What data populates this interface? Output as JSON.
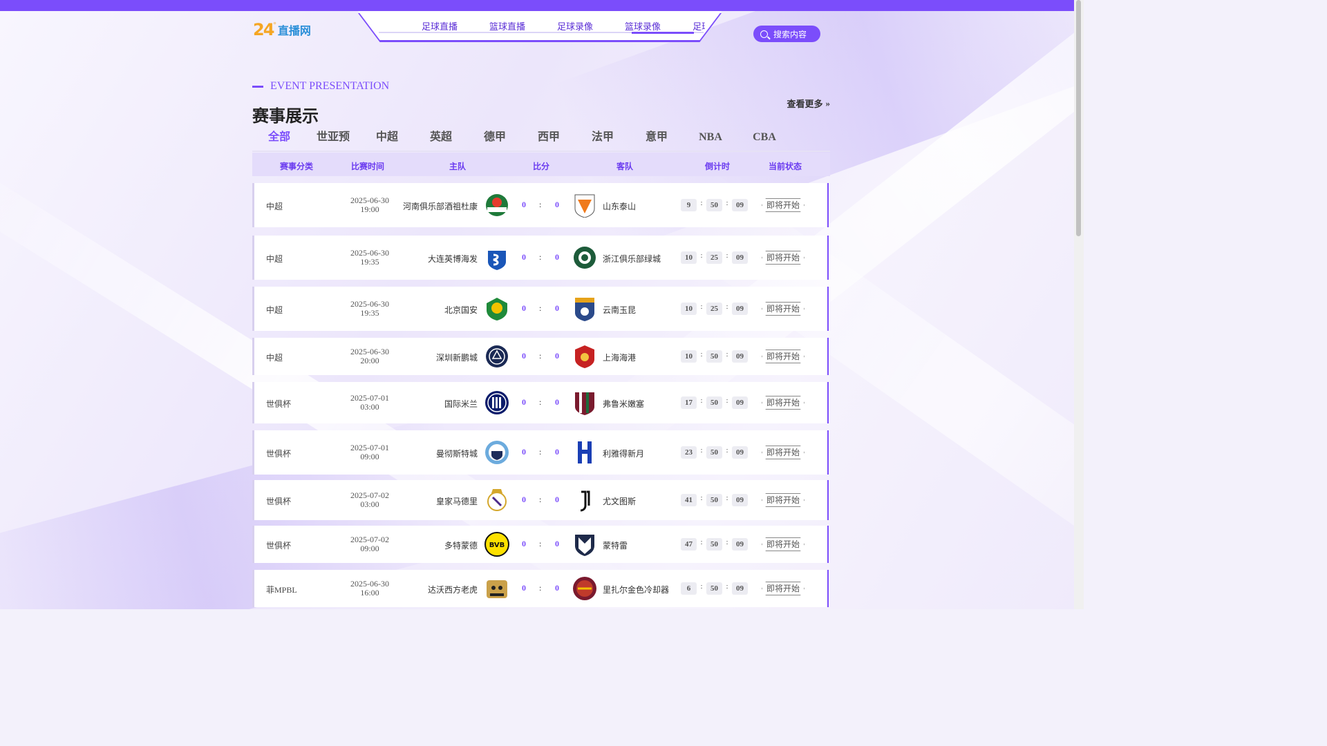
{
  "header": {
    "logo_num": "24",
    "logo_deg": "°",
    "logo_text": "直播网",
    "nav": [
      "足球直播",
      "篮球直播",
      "足球录像",
      "篮球录像",
      "足球"
    ],
    "search_placeholder": "搜索内容"
  },
  "section": {
    "eng_title": "EVENT PRESENTATION",
    "title": "赛事展示",
    "more": "查看更多",
    "tabs": [
      "全部",
      "世亚预",
      "中超",
      "英超",
      "德甲",
      "西甲",
      "法甲",
      "意甲",
      "NBA",
      "CBA"
    ],
    "active_tab": "全部"
  },
  "table": {
    "headers": [
      "赛事分类",
      "比赛时间",
      "主队",
      "比分",
      "客队",
      "倒计时",
      "当前状态"
    ],
    "rows": [
      {
        "category": "中超",
        "date": "2025-06-30",
        "time": "19:00",
        "home": "河南俱乐部酒祖杜康",
        "home_score": "0",
        "away_score": "0",
        "away": "山东泰山",
        "cd": [
          "9",
          "50",
          "09"
        ],
        "status": "即将开始",
        "home_logo": "henan-logo",
        "away_logo": "shandong-logo"
      },
      {
        "category": "中超",
        "date": "2025-06-30",
        "time": "19:35",
        "home": "大连英博海发",
        "home_score": "0",
        "away_score": "0",
        "away": "浙江俱乐部绿城",
        "cd": [
          "10",
          "25",
          "09"
        ],
        "status": "即将开始",
        "home_logo": "dalian-logo",
        "away_logo": "zhejiang-logo"
      },
      {
        "category": "中超",
        "date": "2025-06-30",
        "time": "19:35",
        "home": "北京国安",
        "home_score": "0",
        "away_score": "0",
        "away": "云南玉昆",
        "cd": [
          "10",
          "25",
          "09"
        ],
        "status": "即将开始",
        "home_logo": "beijing-logo",
        "away_logo": "yunnan-logo"
      },
      {
        "category": "中超",
        "date": "2025-06-30",
        "time": "20:00",
        "home": "深圳新鹏城",
        "home_score": "0",
        "away_score": "0",
        "away": "上海海港",
        "cd": [
          "10",
          "50",
          "09"
        ],
        "status": "即将开始",
        "home_logo": "shenzhen-logo",
        "away_logo": "shanghai-logo"
      },
      {
        "category": "世俱杯",
        "date": "2025-07-01",
        "time": "03:00",
        "home": "国际米兰",
        "home_score": "0",
        "away_score": "0",
        "away": "弗鲁米嫩塞",
        "cd": [
          "17",
          "50",
          "09"
        ],
        "status": "即将开始",
        "home_logo": "inter-logo",
        "away_logo": "fluminense-logo"
      },
      {
        "category": "世俱杯",
        "date": "2025-07-01",
        "time": "09:00",
        "home": "曼彻斯特城",
        "home_score": "0",
        "away_score": "0",
        "away": "利雅得新月",
        "cd": [
          "23",
          "50",
          "09"
        ],
        "status": "即将开始",
        "home_logo": "mancity-logo",
        "away_logo": "alhilal-logo"
      },
      {
        "category": "世俱杯",
        "date": "2025-07-02",
        "time": "03:00",
        "home": "皇家马德里",
        "home_score": "0",
        "away_score": "0",
        "away": "尤文图斯",
        "cd": [
          "41",
          "50",
          "09"
        ],
        "status": "即将开始",
        "home_logo": "realmadrid-logo",
        "away_logo": "juventus-logo"
      },
      {
        "category": "世俱杯",
        "date": "2025-07-02",
        "time": "09:00",
        "home": "多特蒙德",
        "home_score": "0",
        "away_score": "0",
        "away": "蒙特雷",
        "cd": [
          "47",
          "50",
          "09"
        ],
        "status": "即将开始",
        "home_logo": "dortmund-logo",
        "away_logo": "monterrey-logo"
      },
      {
        "category": "菲MPBL",
        "date": "2025-06-30",
        "time": "16:00",
        "home": "达沃西方老虎",
        "home_score": "0",
        "away_score": "0",
        "away": "里扎尔金色冷却器",
        "cd": [
          "6",
          "50",
          "09"
        ],
        "status": "即将开始",
        "home_logo": "davao-logo",
        "away_logo": "rizal-logo"
      }
    ]
  },
  "colors": {
    "accent": "#7b4dfb",
    "header_bg": "#e4dcfb",
    "score": "#7b4dfb"
  }
}
